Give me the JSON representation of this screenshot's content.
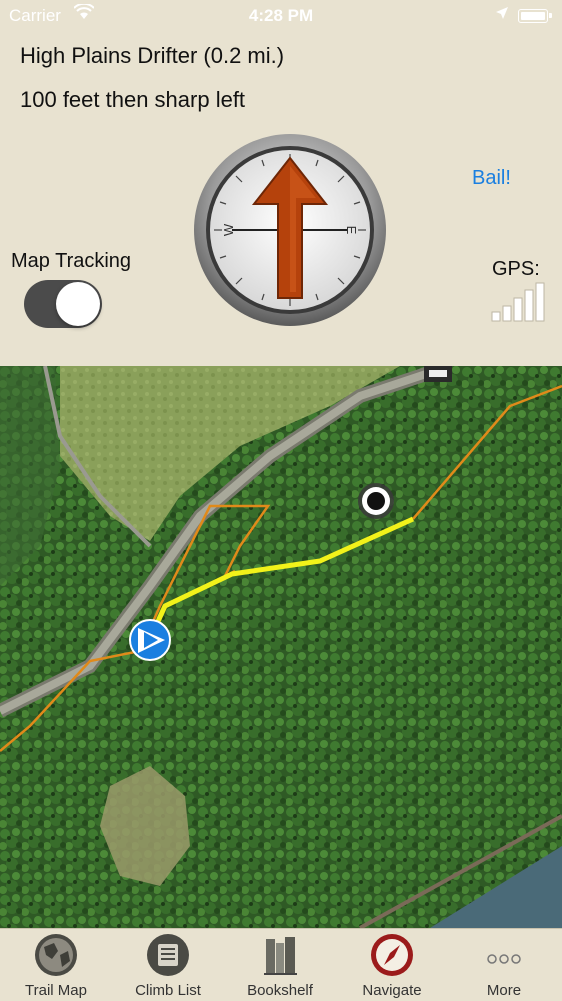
{
  "status": {
    "carrier": "Carrier",
    "time": "4:28 PM"
  },
  "route": {
    "title": "High Plains Drifter (0.2 mi.)",
    "instruction": "100 feet then sharp left"
  },
  "bail_label": "Bail!",
  "map_tracking": {
    "label": "Map Tracking",
    "enabled": true
  },
  "gps": {
    "label": "GPS:",
    "bars_active": 5,
    "bars_total": 5
  },
  "compass": {
    "letters": [
      "W",
      "E"
    ],
    "heading": "forward"
  },
  "tabs": [
    {
      "label": "Trail Map",
      "icon": "globe-icon",
      "active": false
    },
    {
      "label": "Climb List",
      "icon": "list-icon",
      "active": false
    },
    {
      "label": "Bookshelf",
      "icon": "books-icon",
      "active": false
    },
    {
      "label": "Navigate",
      "icon": "compass-icon",
      "active": true
    },
    {
      "label": "More",
      "icon": "more-icon",
      "active": false
    }
  ],
  "colors": {
    "panel_bg": "#e8e2d0",
    "accent_link": "#1a7fe0",
    "route_line": "#f2f21a",
    "trail_line": "#e08a1a",
    "active_tab": "#9b1b1b"
  }
}
